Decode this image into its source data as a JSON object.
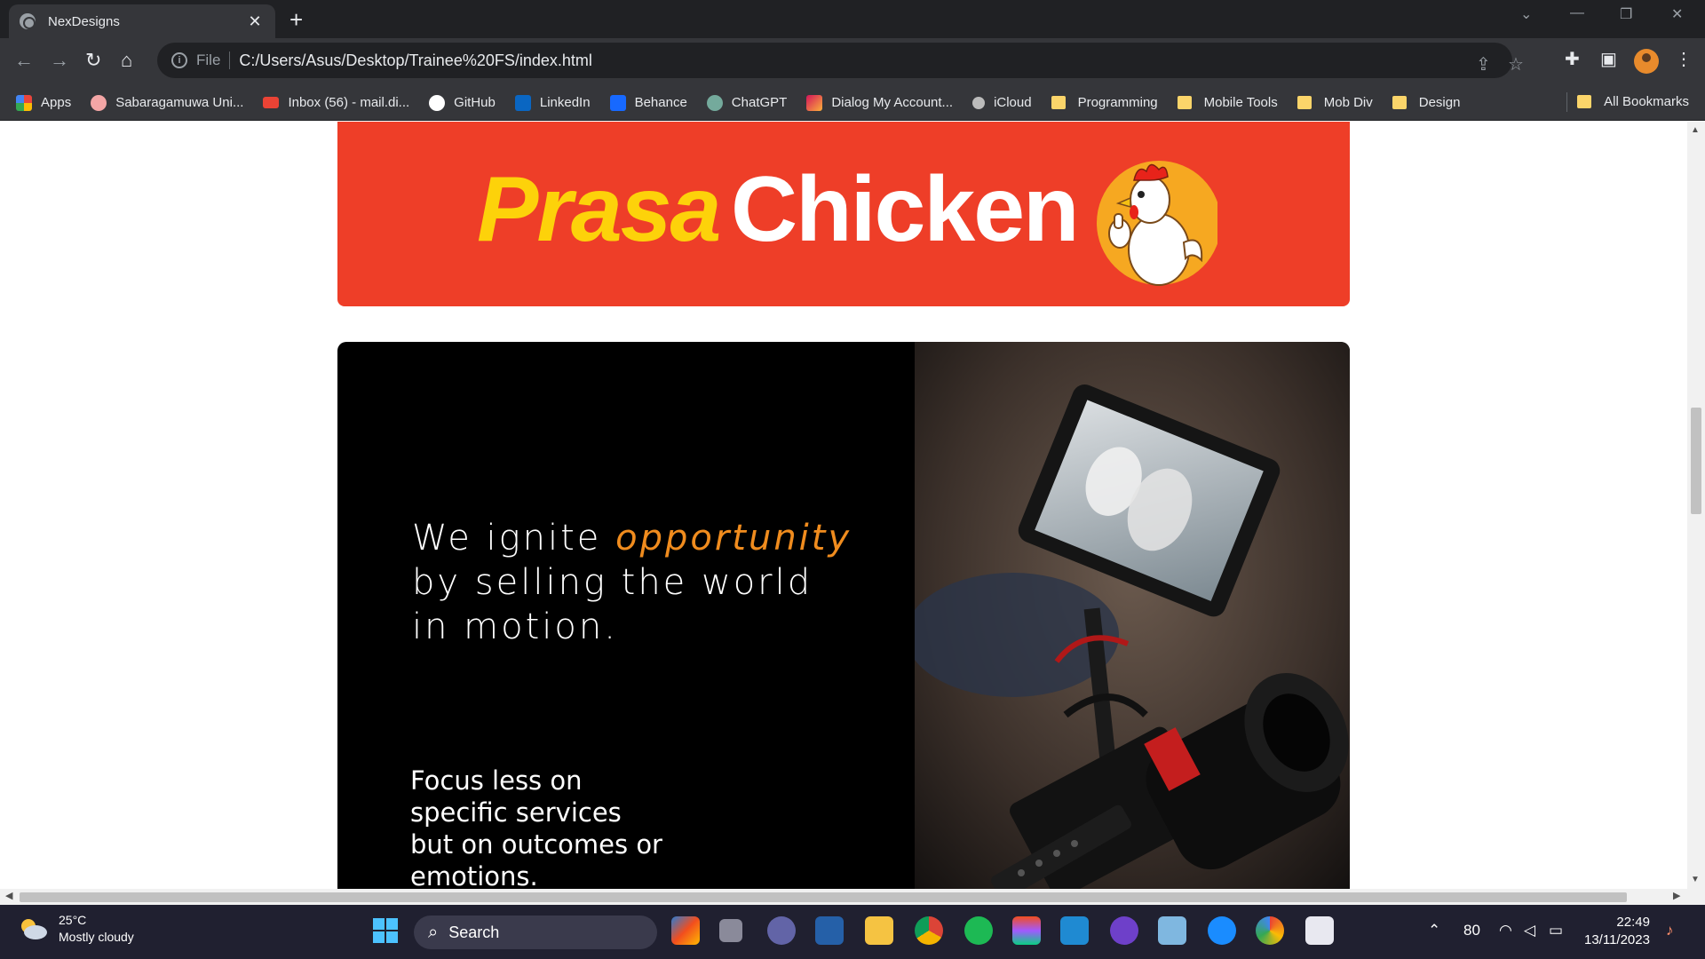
{
  "browser": {
    "tab_title": "NexDesigns",
    "tab_close": "✕",
    "new_tab": "+",
    "address_prefix": "File",
    "address_info": "i",
    "address_url": "C:/Users/Asus/Desktop/Trainee%20FS/index.html"
  },
  "bookmarks": {
    "items": [
      {
        "label": "Apps",
        "icon": "apps-grid-icon",
        "color": "#e8453c"
      },
      {
        "label": "Sabaragamuwa Uni...",
        "icon": "university-icon",
        "color": "#f4a6a6"
      },
      {
        "label": "Inbox (56) - mail.di...",
        "icon": "gmail-icon",
        "color": "#ea4335"
      },
      {
        "label": "GitHub",
        "icon": "github-icon",
        "color": "#ffffff"
      },
      {
        "label": "LinkedIn",
        "icon": "linkedin-icon",
        "color": "#0a66c2"
      },
      {
        "label": "Behance",
        "icon": "behance-icon",
        "color": "#1769ff"
      },
      {
        "label": "ChatGPT",
        "icon": "chatgpt-icon",
        "color": "#74aa9c"
      },
      {
        "label": "Dialog My Account...",
        "icon": "dialog-icon",
        "color": "#d4145a"
      },
      {
        "label": "iCloud",
        "icon": "apple-icon",
        "color": "#bbbbbb"
      }
    ],
    "folders": [
      "Programming",
      "Mobile Tools",
      "Mob Div",
      "Design"
    ],
    "all_bookmarks": "All Bookmarks"
  },
  "page": {
    "banner": {
      "brand_part1": "Prasa",
      "brand_part2": "Chicken",
      "banner_color": "#ee3e28",
      "accent_yellow": "#fdd20a"
    },
    "hero": {
      "headline_pre": "We ignite ",
      "headline_highlight": "opportunity",
      "headline_line2": "by selling the world",
      "headline_line3": "in motion.",
      "sub_line1": "Focus less on",
      "sub_line2": "specific services",
      "sub_line3": "but on outcomes or",
      "sub_line4": "emotions.",
      "highlight_color": "#f08c1e"
    }
  },
  "taskbar": {
    "temperature": "25°C",
    "weather": "Mostly cloudy",
    "search_label": "Search",
    "battery": "80",
    "time": "22:49",
    "date": "13/11/2023"
  }
}
